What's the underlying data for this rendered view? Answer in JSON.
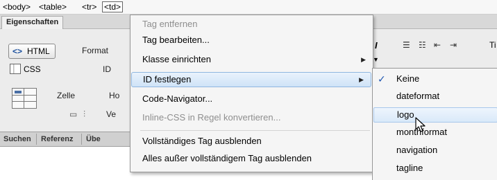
{
  "tag_selector": {
    "body": "<body>",
    "table": "<table>",
    "tr": "<tr>",
    "td": "<td>"
  },
  "panel": {
    "tab": "Eigenschaften",
    "html_button": "HTML",
    "css_button": "CSS",
    "format_label": "Format",
    "id_label": "ID",
    "zelle_label": "Zelle",
    "ho_label": "Ho",
    "ve_label": "Ve",
    "bottom_tabs": [
      "Suchen",
      "Referenz",
      "Übe"
    ]
  },
  "background_toolbar": {
    "trailing_label": "Ti"
  },
  "context_menu": {
    "items": [
      {
        "label": "Tag entfernen",
        "enabled": false
      },
      {
        "label": "Tag bearbeiten...",
        "enabled": true
      },
      {
        "label": "Klasse einrichten",
        "enabled": true,
        "submenu": true
      },
      {
        "label": "ID festlegen",
        "enabled": true,
        "submenu": true,
        "highlighted": true
      },
      {
        "label": "Code-Navigator...",
        "enabled": true
      },
      {
        "label": "Inline-CSS in Regel konvertieren...",
        "enabled": false
      },
      {
        "label": "Vollständiges Tag ausblenden",
        "enabled": true
      },
      {
        "label": "Alles außer vollständigem Tag ausblenden",
        "enabled": true
      }
    ]
  },
  "id_submenu": {
    "items": [
      {
        "label": "Keine",
        "checked": true
      },
      {
        "label": "dateformat"
      },
      {
        "label": "logo",
        "hovered": true
      },
      {
        "label": "monthformat"
      },
      {
        "label": "navigation"
      },
      {
        "label": "tagline"
      }
    ]
  },
  "icons": {
    "html": "code-brackets-icon",
    "css": "css-layout-icon",
    "cell": "table-cell-icon",
    "submenu_arrow": "chevron-right-icon",
    "check": "checkmark-icon",
    "cursor": "mouse-pointer-icon"
  },
  "colors": {
    "menu_background": "#f5f5f5",
    "highlight_border": "#8fb6e0",
    "highlight_fill": "#cfe3f7",
    "disabled_text": "#8e8e8e",
    "check_color": "#1e56b0"
  }
}
